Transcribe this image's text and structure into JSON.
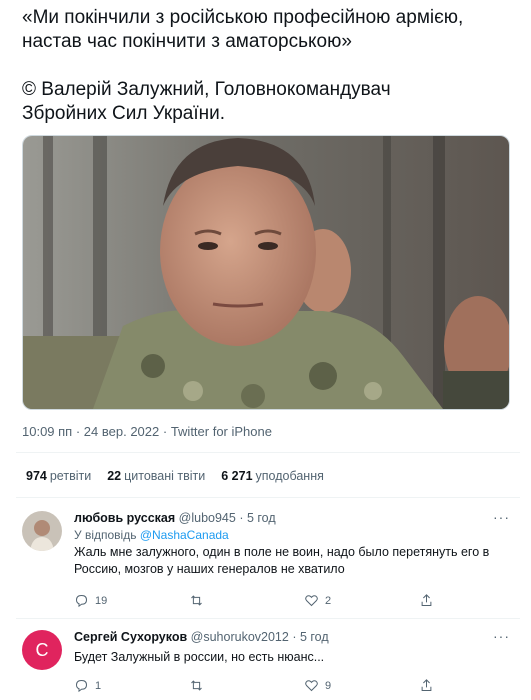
{
  "tweet": {
    "line1": "«Ми покінчили з російською професійною армією,",
    "line2": "настав час покінчити з аматорською»",
    "line3": "© Валерій Залужний, Головнокомандувач",
    "line4": "Збройних Сил України.",
    "time": "10:09 пп",
    "date": "24 вер. 2022",
    "source": "Twitter for iPhone"
  },
  "stats": {
    "retweets_count": "974",
    "retweets_label": "ретвіти",
    "quotes_count": "22",
    "quotes_label": "цитовані твіти",
    "likes_count": "6 271",
    "likes_label": "уподобання"
  },
  "replies": [
    {
      "name": "любовь русская",
      "handle": "@lubo945",
      "date": "5 год",
      "reply_to_prefix": "У відповідь",
      "reply_to_handle": "@NashaCanada",
      "text": "Жаль мне залужного, один в поле не воин, надо было перетянуть его в Россию, мозгов у наших генералов не хватило",
      "replies_count": "19",
      "retweets_count": "",
      "likes_count": "2",
      "avatar_letter": ""
    },
    {
      "name": "Сергей Сухоруков",
      "handle": "@suhorukov2012",
      "date": "5 год",
      "text": "Будет Залужный в россии, но есть нюанс...",
      "replies_count": "1",
      "retweets_count": "",
      "likes_count": "9",
      "avatar_letter": "С"
    }
  ],
  "colors": {
    "link": "#1d9bf0",
    "muted": "#536471",
    "text": "#0f1419",
    "avatar_bg": "#e0245e"
  },
  "icons": [
    "more-icon",
    "reply-icon",
    "retweet-icon",
    "like-icon",
    "share-icon"
  ]
}
